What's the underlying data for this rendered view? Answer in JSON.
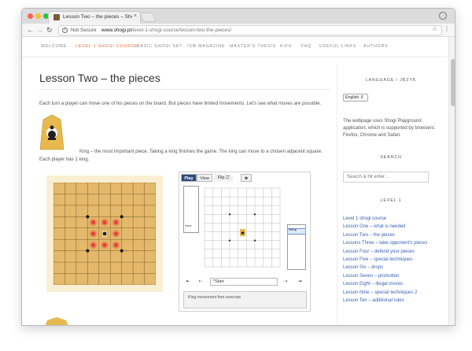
{
  "browser": {
    "tab_title": "Lesson Two – the pieces – Shog",
    "security_label": "Not Secure",
    "url_host": "www.shogi.pl",
    "url_path": "/level-1-shogi-course/lesson-two-the-pieces/"
  },
  "nav": {
    "items": [
      "WELCOME",
      "LEVEL 1 SHOGI COURSE",
      "BASIC SHOGI SET",
      "ISM MAGAZINE",
      "MASTER'S THESIS",
      "KIFU",
      "FAQ",
      "USEFUL LINKS",
      "AUTHORS"
    ],
    "active_index": 1,
    "active_color": "#e2693c"
  },
  "article": {
    "title": "Lesson Two – the pieces",
    "intro": "Each turn a player can move one of his pieces on the board. But pieces have limited movements. Let's see what moves are possible.",
    "king_text": "King – the most important piece. Taking a king finishes the game. The king can move to a chosen adjacent square. Each player has 1 king."
  },
  "exercise": {
    "tabs": {
      "play": "Play",
      "view": "View",
      "flip": "Flip ⮂"
    },
    "hand_label": "Hand",
    "start_label": "*Start",
    "first_btn": "⇤",
    "prev_btn": "⇠",
    "next_btn": "⇢",
    "last_btn": "⇥",
    "list_entry": "Start ◆",
    "note": "King movement free exercise"
  },
  "sidebar": {
    "language_title": "LANGUAGE / JĘZYK",
    "language_value": "English ⇕",
    "info": "The webpage uses Shogi Playground application, which is supported by browsers: Firefox, Chrome and Safari.",
    "search_title": "SEARCH",
    "search_placeholder": "Search & hit enter…",
    "level_title": "LEVEL 1",
    "lessons": [
      "Level 1 shogi course",
      "Lesson One – what is needed",
      "Lesson Two – the pieces",
      "Lessons Three – take opponent's pieces",
      "Lesson Four – defend your pieces",
      "Lesson Five – special techniques",
      "Lesson Six – drops",
      "Lesson Seven – promotion",
      "Lesson Eight – illegal moves",
      "Lesson Nine – special techniques 2",
      "Lesson Ten – additional rules"
    ]
  },
  "colors": {
    "link": "#3a62b3",
    "board": "#e4b96b",
    "board_frame": "#fbefd3",
    "move_marker": "#e6453c",
    "play_tab": "#2f4a7a"
  },
  "icons": {
    "king_piece": "king-piece-icon",
    "refresh": "refresh-icon",
    "star": "star-icon",
    "menu": "kebab-menu-icon"
  }
}
